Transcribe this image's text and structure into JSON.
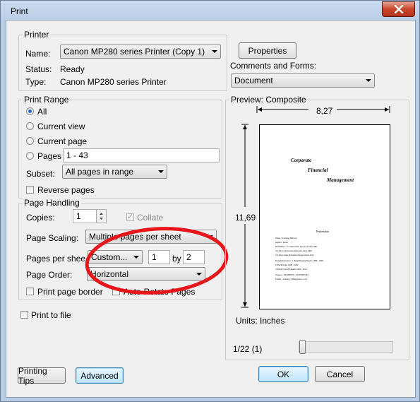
{
  "window": {
    "title": "Print"
  },
  "printer": {
    "group_title": "Printer",
    "name_label": "Name:",
    "name_value": "Canon MP280 series Printer (Copy 1)",
    "properties_button": "Properties",
    "status_label": "Status:",
    "status_value": "Ready",
    "type_label": "Type:",
    "type_value": "Canon MP280 series Printer",
    "comments_label": "Comments and Forms:",
    "comments_value": "Document"
  },
  "print_range": {
    "group_title": "Print Range",
    "all": "All",
    "current_view": "Current view",
    "current_page": "Current page",
    "pages": "Pages",
    "pages_value": "1 - 43",
    "subset_label": "Subset:",
    "subset_value": "All pages in range",
    "reverse_pages": "Reverse pages"
  },
  "page_handling": {
    "group_title": "Page Handling",
    "copies_label": "Copies:",
    "copies_value": "1",
    "collate": "Collate",
    "page_scaling_label": "Page Scaling:",
    "page_scaling_value": "Multiple pages per sheet",
    "pages_per_sheet_label": "Pages per shee",
    "pages_per_sheet_value": "Custom...",
    "pps_x": "1",
    "by_label": "by",
    "pps_y": "2",
    "page_order_label": "Page Order:",
    "page_order_value": "Horizontal",
    "print_page_border": "Print page border",
    "auto_rotate": "Auto-Rotate Pages"
  },
  "print_to_file": "Print to file",
  "preview": {
    "group_title": "Preview: Composite",
    "width": "8,27",
    "height": "11,69",
    "units": "Units: Inches",
    "page_counter": "1/22 (1)",
    "page_position": 0.0,
    "document": {
      "title_line1": "Corporate",
      "title_line2": "Financial",
      "title_line3": "Management",
      "heading": "Perkenalan",
      "rows": [
        "Nama          :  Santiang Hidayas",
        "Agama         :  Islam",
        "Pendidikan    :  S.1 Universitas Jaya Jaya lulus 1991",
        "                 S.2 Pasca Universitas Indonesia lulus 1998",
        "                 S.3 Pasca lulus Perbankan Negeri tahun 2012",
        "Pengalaman kerja :  1. Bank Dagang Negara 1989 - 1999",
        "                 2. Bank Niaga 1999 - 2002",
        "                 3. Bank Syariah Mandiri 2009 - 2012",
        "Telepon       :  0819987076 - 0818 6007363",
        "E-mail        :  santiang_1969@yahoo.co.id"
      ]
    }
  },
  "buttons": {
    "printing_tips": "Printing Tips",
    "advanced": "Advanced",
    "ok": "OK",
    "cancel": "Cancel"
  }
}
